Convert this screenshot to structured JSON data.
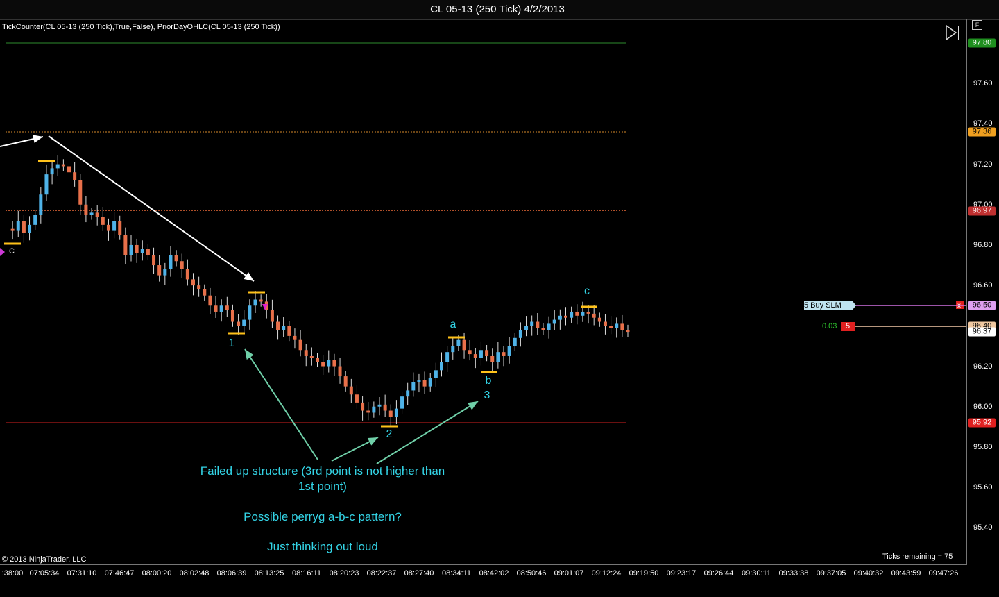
{
  "window": {
    "title": "CL 05-13 (250 Tick)  4/2/2013",
    "f_button": "F"
  },
  "indicator_text": "TickCounter(CL 05-13 (250 Tick),True,False), PriorDayOHLC(CL 05-13 (250 Tick))",
  "copyright": "© 2013 NinjaTrader, LLC",
  "ticks_remaining": "Ticks remaining = 75",
  "price_badges": {
    "high": "97.80",
    "open": "97.36",
    "close_prior": "96.97",
    "buy_order": "96.50",
    "pos_entry": "96.40",
    "last": "96.37",
    "low": "95.92"
  },
  "order": {
    "buy_label": "5  Buy SLM",
    "pl": "0.03",
    "qty": "5"
  },
  "annotations": {
    "c_left": "C",
    "point1": "1",
    "point2": "2",
    "point3": "3",
    "wave_a": "a",
    "wave_b": "b",
    "wave_c": "c",
    "note_line1": "Failed up structure (3rd point is not higher than",
    "note_line2": "1st point)",
    "note_q": "Possible perryg a-b-c pattern?",
    "note_think": "Just thinking out loud"
  },
  "colors": {
    "up_candle": "#4fb3e8",
    "down_candle": "#e8704a",
    "high_line": "#2e8b2e",
    "low_line": "#d42020",
    "open_line": "#d88a2a",
    "prior_close_line": "#b0502a",
    "annotation_text": "#33d4e6",
    "marker": "#ffc21a",
    "arrow_teal": "#6fcfa8"
  },
  "chart_data": {
    "type": "candlestick",
    "instrument": "CL 05-13 (250 Tick)",
    "date": "4/2/2013",
    "ylim": [
      95.22,
      97.9
    ],
    "y_ticks": [
      95.4,
      95.6,
      95.8,
      96.0,
      96.2,
      96.4,
      96.6,
      96.8,
      97.0,
      97.2,
      97.4,
      97.6
    ],
    "x_tick_labels": [
      ":38:00",
      "07:05:34",
      "07:31:10",
      "07:46:47",
      "08:00:20",
      "08:02:48",
      "08:06:39",
      "08:13:25",
      "08:16:11",
      "08:20:23",
      "08:22:37",
      "08:27:40",
      "08:34:11",
      "08:42:02",
      "08:50:46",
      "09:01:07",
      "09:12:24",
      "09:19:50",
      "09:23:17",
      "09:26:44",
      "09:30:11",
      "09:33:38",
      "09:37:05",
      "09:40:32",
      "09:43:59",
      "09:47:26"
    ],
    "reference_lines": {
      "prior_high": 97.8,
      "prior_open": 97.36,
      "prior_close": 96.97,
      "prior_low": 95.92
    },
    "key_points": [
      {
        "label": "1",
        "price": 96.38
      },
      {
        "label": "2",
        "price": 95.92
      },
      {
        "label": "3 / b",
        "price": 96.18
      },
      {
        "label": "a",
        "price": 96.35
      },
      {
        "label": "c",
        "price": 96.5
      }
    ],
    "close_path": [
      96.88,
      96.87,
      96.92,
      96.86,
      96.9,
      96.95,
      97.05,
      97.15,
      97.18,
      97.2,
      97.19,
      97.16,
      97.12,
      97.0,
      96.95,
      96.96,
      96.94,
      96.9,
      96.87,
      96.92,
      96.85,
      96.75,
      96.8,
      96.76,
      96.78,
      96.75,
      96.7,
      96.65,
      96.68,
      96.75,
      96.72,
      96.68,
      96.63,
      96.6,
      96.58,
      96.55,
      96.5,
      96.47,
      96.5,
      96.48,
      96.42,
      96.4,
      96.43,
      96.5,
      96.53,
      96.52,
      96.48,
      96.42,
      96.38,
      96.4,
      96.35,
      96.33,
      96.28,
      96.25,
      96.24,
      96.22,
      96.2,
      96.23,
      96.2,
      96.15,
      96.1,
      96.06,
      96.02,
      95.98,
      95.97,
      96.0,
      96.01,
      95.98,
      95.95,
      95.99,
      96.05,
      96.08,
      96.12,
      96.13,
      96.1,
      96.14,
      96.18,
      96.22,
      96.27,
      96.3,
      96.33,
      96.28,
      96.26,
      96.24,
      96.28,
      96.25,
      96.22,
      96.27,
      96.25,
      96.3,
      96.34,
      96.38,
      96.4,
      96.42,
      96.39,
      96.38,
      96.41,
      96.43,
      96.45,
      96.44,
      96.47,
      96.45,
      96.47,
      96.46,
      96.44,
      96.42,
      96.4,
      96.39,
      96.41,
      96.38,
      96.37
    ]
  }
}
